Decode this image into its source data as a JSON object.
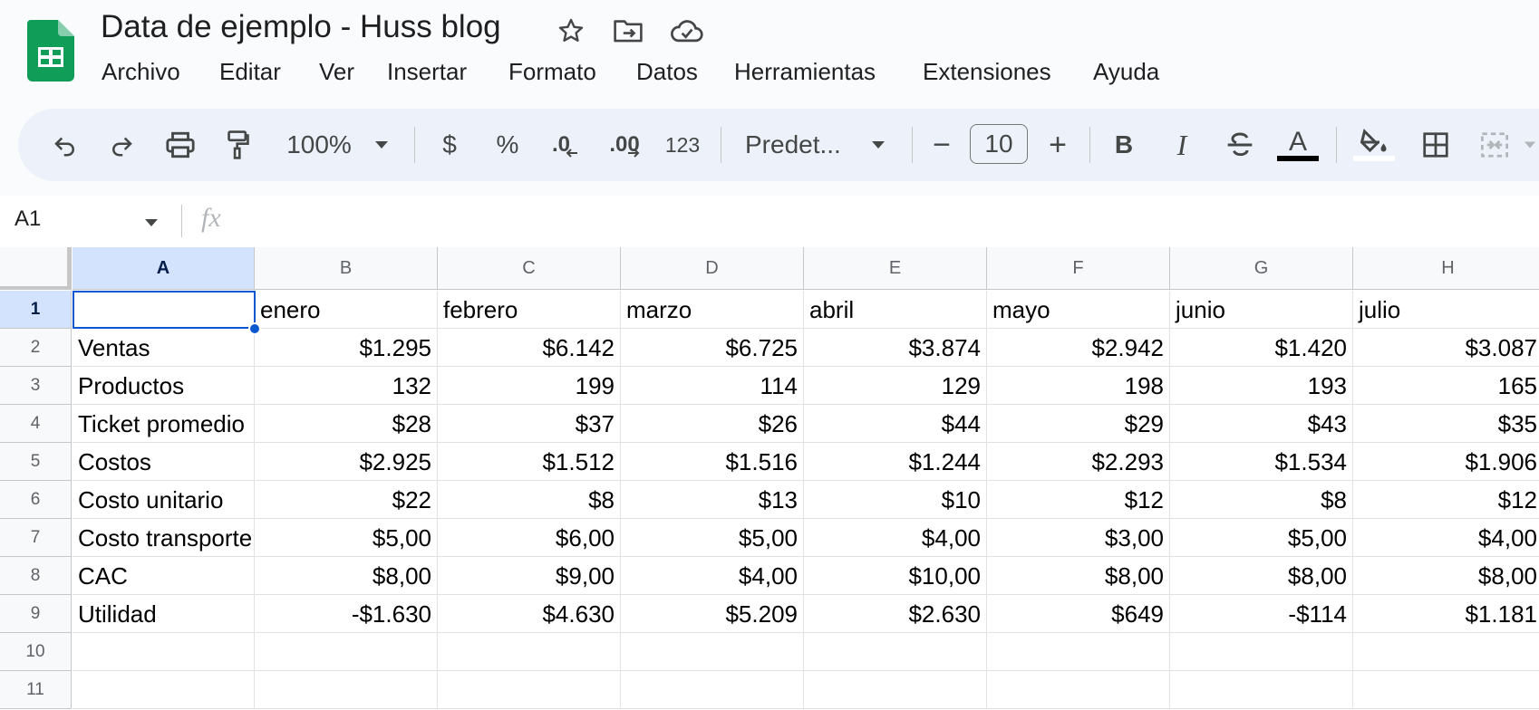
{
  "doc_title": "Data de ejemplo - Huss blog",
  "menu": [
    "Archivo",
    "Editar",
    "Ver",
    "Insertar",
    "Formato",
    "Datos",
    "Herramientas",
    "Extensiones",
    "Ayuda"
  ],
  "toolbar": {
    "zoom": "100%",
    "currency": "$",
    "percent": "%",
    "dec_decrease": ".0",
    "dec_increase": ".00",
    "number_format": "123",
    "font": "Predet...",
    "font_size": "10",
    "minus": "−",
    "plus": "+",
    "bold": "B",
    "italic": "I",
    "text_color": "A"
  },
  "formula_bar": {
    "name_box": "A1",
    "fx": "fx",
    "value": ""
  },
  "columns": [
    "A",
    "B",
    "C",
    "D",
    "E",
    "F",
    "G",
    "H"
  ],
  "rows": [
    "1",
    "2",
    "3",
    "4",
    "5",
    "6",
    "7",
    "8",
    "9",
    "10",
    "11"
  ],
  "cells": [
    [
      "",
      "enero",
      "febrero",
      "marzo",
      "abril",
      "mayo",
      "junio",
      "julio"
    ],
    [
      "Ventas",
      "$1.295",
      "$6.142",
      "$6.725",
      "$3.874",
      "$2.942",
      "$1.420",
      "$3.087"
    ],
    [
      "Productos",
      "132",
      "199",
      "114",
      "129",
      "198",
      "193",
      "165"
    ],
    [
      "Ticket promedio",
      "$28",
      "$37",
      "$26",
      "$44",
      "$29",
      "$43",
      "$35"
    ],
    [
      "Costos",
      "$2.925",
      "$1.512",
      "$1.516",
      "$1.244",
      "$2.293",
      "$1.534",
      "$1.906"
    ],
    [
      "Costo unitario",
      "$22",
      "$8",
      "$13",
      "$10",
      "$12",
      "$8",
      "$12"
    ],
    [
      "Costo transporte",
      "$5,00",
      "$6,00",
      "$5,00",
      "$4,00",
      "$3,00",
      "$5,00",
      "$4,00"
    ],
    [
      "CAC",
      "$8,00",
      "$9,00",
      "$4,00",
      "$10,00",
      "$8,00",
      "$8,00",
      "$8,00"
    ],
    [
      "Utilidad",
      "-$1.630",
      "$4.630",
      "$5.209",
      "$2.630",
      "$649",
      "-$114",
      "$1.181"
    ],
    [
      "",
      "",
      "",
      "",
      "",
      "",
      "",
      ""
    ],
    [
      "",
      "",
      "",
      "",
      "",
      "",
      "",
      ""
    ]
  ],
  "colors": {
    "sheets_green": "#0f9d58",
    "selection": "#0b57d0",
    "header_selected": "#d3e3fd"
  },
  "icons": [
    "sheets-logo",
    "star-icon",
    "move-folder-icon",
    "cloud-saved-icon",
    "undo-icon",
    "redo-icon",
    "print-icon",
    "paint-format-icon",
    "dropdown-icon",
    "strikethrough-icon",
    "fill-color-icon",
    "borders-icon",
    "merge-cells-icon"
  ]
}
